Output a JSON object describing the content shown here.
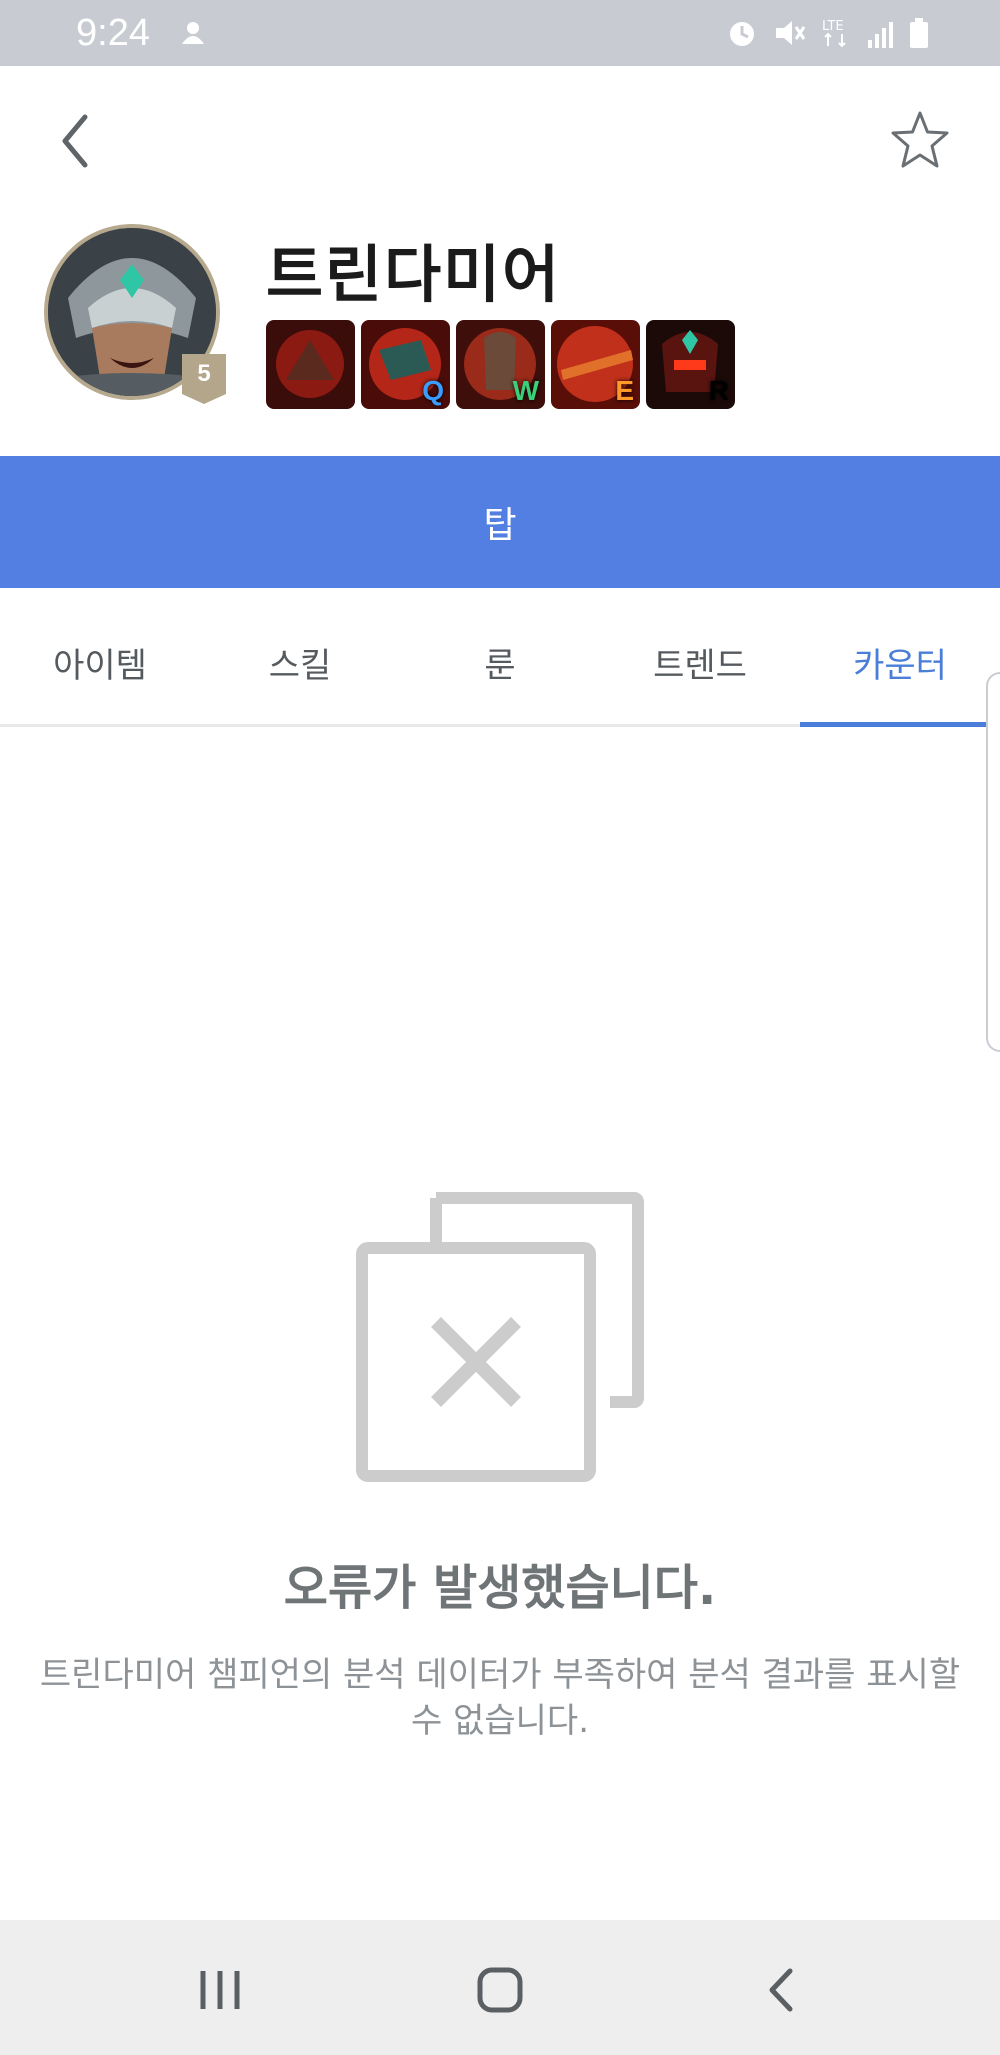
{
  "status_bar": {
    "time": "9:24",
    "icons": [
      "notification-icon",
      "alarm-icon",
      "mute-icon",
      "lte-icon",
      "signal-icon",
      "battery-icon"
    ]
  },
  "header": {
    "back_icon": "back-arrow-icon",
    "favorite_icon": "star-outline-icon"
  },
  "champion": {
    "name": "트린다미어",
    "level": "5",
    "skills": [
      {
        "key": "",
        "color": "#8a1a12",
        "key_color": "#ffffff"
      },
      {
        "key": "Q",
        "color": "#b32618",
        "key_color": "#3b9cff"
      },
      {
        "key": "W",
        "color": "#9a2a1a",
        "key_color": "#3ad07a"
      },
      {
        "key": "E",
        "color": "#c0301a",
        "key_color": "#ff9a2a"
      },
      {
        "key": "R",
        "color": "#5a1410",
        "key_color": "#ffffff"
      }
    ]
  },
  "role": {
    "label": "탑",
    "color": "#537fe3"
  },
  "tabs": [
    {
      "label": "아이템",
      "active": false
    },
    {
      "label": "스킬",
      "active": false
    },
    {
      "label": "룬",
      "active": false
    },
    {
      "label": "트렌드",
      "active": false
    },
    {
      "label": "카운터",
      "active": true
    }
  ],
  "error": {
    "icon": "error-copy-icon",
    "title": "오류가 발생했습니다.",
    "description_line1": "트린다미어 챔피언의 분석 데이터가 부족하여 분석 결과를 표시할",
    "description_line2": "수 없습니다."
  },
  "nav_bar": {
    "buttons": [
      "recent-apps-icon",
      "home-icon",
      "back-icon"
    ]
  },
  "colors": {
    "accent": "#4a7ed8",
    "status_bar": "#c8ccd2"
  }
}
